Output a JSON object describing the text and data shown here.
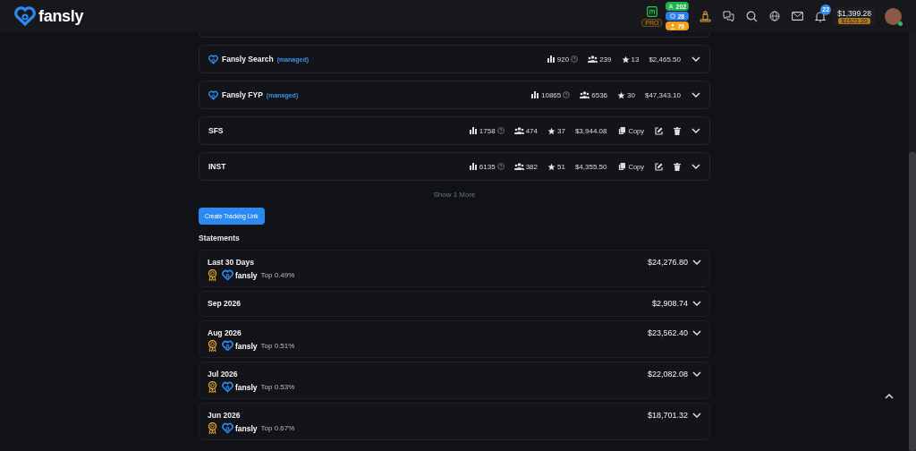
{
  "header": {
    "logo": "fansly",
    "pro_label": "PRO",
    "badges": [
      {
        "text": "202",
        "color": "#22b14c"
      },
      {
        "text": "28",
        "color": "#2b7de9"
      },
      {
        "text": "70",
        "color": "#f0a020"
      }
    ],
    "notification_count": "22",
    "balance": "$1,399.28",
    "pending": "$1523.20",
    "avatar_online": true
  },
  "links": [
    {
      "kind": "managed",
      "name": "Fansly Search",
      "tag": "(managed)",
      "clicks": "920",
      "subs": "239",
      "favs": "13",
      "earnings": "$2,465.50"
    },
    {
      "kind": "managed",
      "name": "Fansly FYP",
      "tag": "(managed)",
      "clicks": "10865",
      "subs": "6536",
      "favs": "30",
      "earnings": "$47,343.10"
    },
    {
      "kind": "custom",
      "name": "SFS",
      "clicks": "1758",
      "subs": "474",
      "favs": "37",
      "earnings": "$3,944.08",
      "copy": "Copy"
    },
    {
      "kind": "custom",
      "name": "INST",
      "clicks": "6135",
      "subs": "382",
      "favs": "51",
      "earnings": "$4,355.50",
      "copy": "Copy"
    }
  ],
  "show_more": "Show 1 More",
  "create_button": "Create Tracking Link",
  "statements_title": "Statements",
  "statements": [
    {
      "period": "Last 30 Days",
      "amount": "$24,276.80",
      "rank": {
        "brand": "fansly",
        "text": "Top 0.49%"
      }
    },
    {
      "period": "Sep 2026",
      "amount": "$2,908.74"
    },
    {
      "period": "Aug 2026",
      "amount": "$23,562.40",
      "rank": {
        "brand": "fansly",
        "text": "Top 0.51%"
      }
    },
    {
      "period": "Jul 2026",
      "amount": "$22,082.08",
      "rank": {
        "brand": "fansly",
        "text": "Top 0.53%"
      }
    },
    {
      "period": "Jun 2026",
      "amount": "$18,701.32",
      "rank": {
        "brand": "fansly",
        "text": "Top 0.67%"
      }
    }
  ]
}
